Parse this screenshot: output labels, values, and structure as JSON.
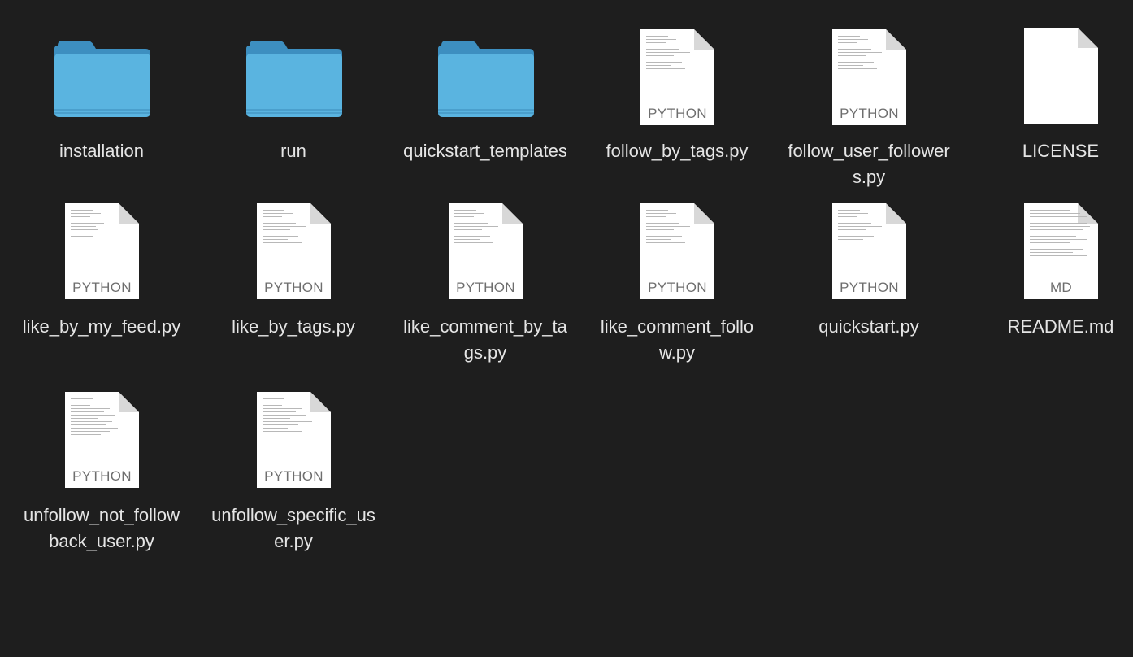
{
  "items": [
    {
      "name": "installation",
      "type": "folder"
    },
    {
      "name": "run",
      "type": "folder"
    },
    {
      "name": "quickstart_templates",
      "type": "folder"
    },
    {
      "name": "follow_by_tags.py",
      "type": "doc",
      "kind": "PYTHON"
    },
    {
      "name": "follow_user_followers.py",
      "type": "doc",
      "kind": "PYTHON"
    },
    {
      "name": "LICENSE",
      "type": "doc",
      "kind": ""
    },
    {
      "name": "like_by_my_feed.py",
      "type": "doc",
      "kind": "PYTHON"
    },
    {
      "name": "like_by_tags.py",
      "type": "doc",
      "kind": "PYTHON"
    },
    {
      "name": "like_comment_by_tags.py",
      "type": "doc",
      "kind": "PYTHON"
    },
    {
      "name": "like_comment_follow.py",
      "type": "doc",
      "kind": "PYTHON"
    },
    {
      "name": "quickstart.py",
      "type": "doc",
      "kind": "PYTHON"
    },
    {
      "name": "README.md",
      "type": "doc",
      "kind": "MD"
    },
    {
      "name": "unfollow_not_followback_user.py",
      "type": "doc",
      "kind": "PYTHON"
    },
    {
      "name": "unfollow_specific_user.py",
      "type": "doc",
      "kind": "PYTHON"
    }
  ],
  "colors": {
    "background": "#1e1e1e",
    "folder": "#5ab4e0",
    "label": "#e5e5e5"
  }
}
